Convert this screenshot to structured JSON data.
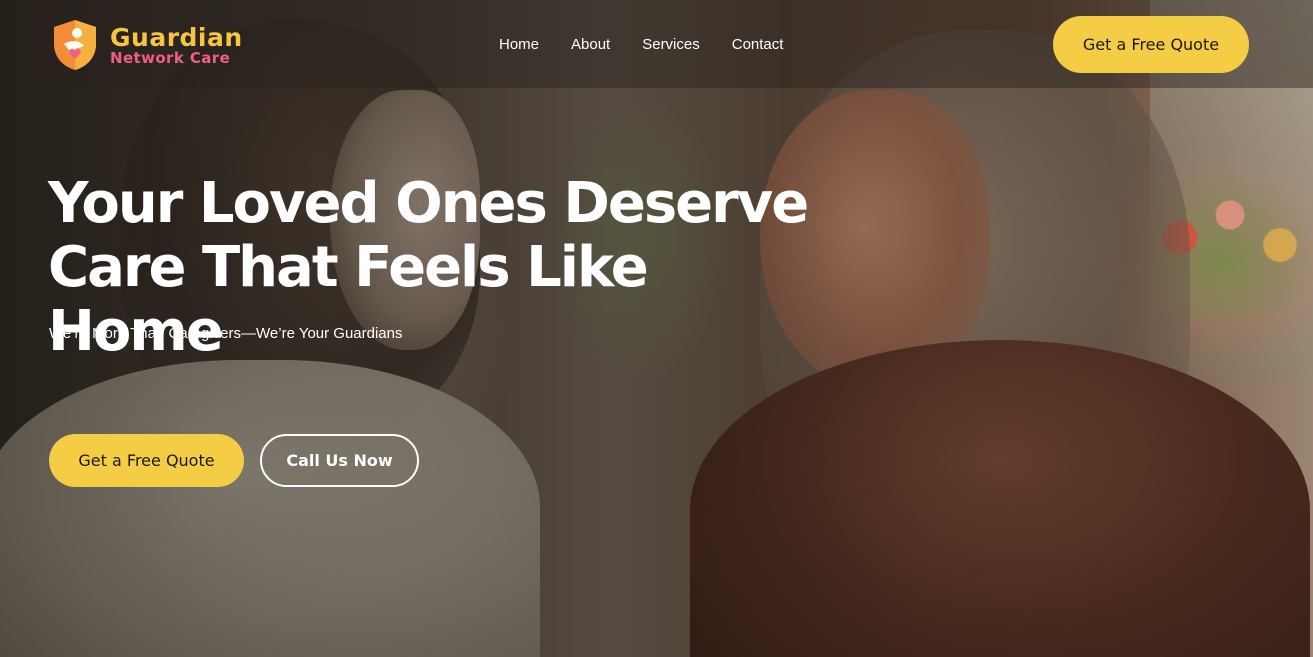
{
  "brand": {
    "name": "Guardian",
    "tagline": "Network Care",
    "colors": {
      "primary_yellow": "#f5cd45",
      "accent_pink": "#ef5d89",
      "logo_orange": "#f28c38"
    }
  },
  "nav": {
    "items": [
      {
        "label": "Home"
      },
      {
        "label": "About"
      },
      {
        "label": "Services"
      },
      {
        "label": "Contact"
      }
    ],
    "cta_label": "Get a Free Quote"
  },
  "hero": {
    "title_line1": "Your Loved Ones Deserve",
    "title_line2": "Care That Feels Like Home",
    "subtitle": "We’re More Than Caregivers—We’re Your Guardians",
    "primary_button": "Get a Free Quote",
    "secondary_button": "Call Us Now",
    "background_image": "photo of a young woman and an elderly woman facing each other in a warm home setting"
  }
}
